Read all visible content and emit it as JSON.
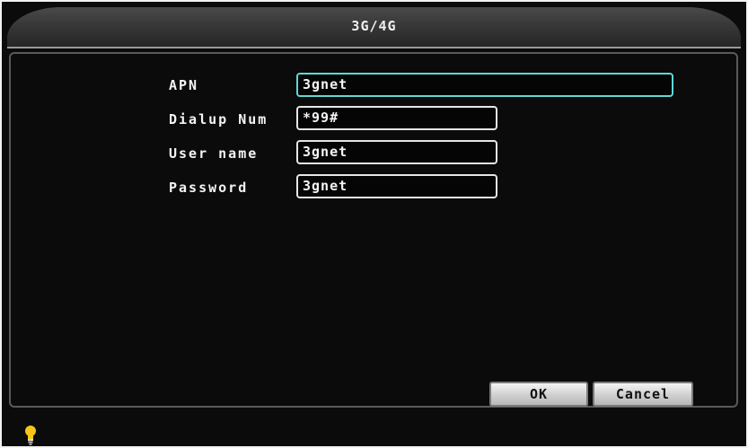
{
  "window": {
    "title": "3G/4G"
  },
  "form": {
    "fields": [
      {
        "label": "APN",
        "value": "3gnet"
      },
      {
        "label": "Dialup Num",
        "value": "*99#"
      },
      {
        "label": "User name",
        "value": "3gnet"
      },
      {
        "label": "Password",
        "value": "3gnet"
      }
    ],
    "focused_field": "APN"
  },
  "buttons": {
    "ok_label": "OK",
    "cancel_label": "Cancel"
  },
  "status": {
    "indicator_icon": "lightbulb-icon",
    "indicator_color": "#f5c518"
  },
  "colors": {
    "focus_border": "#5fd8d8",
    "background": "#0b0b0b"
  }
}
